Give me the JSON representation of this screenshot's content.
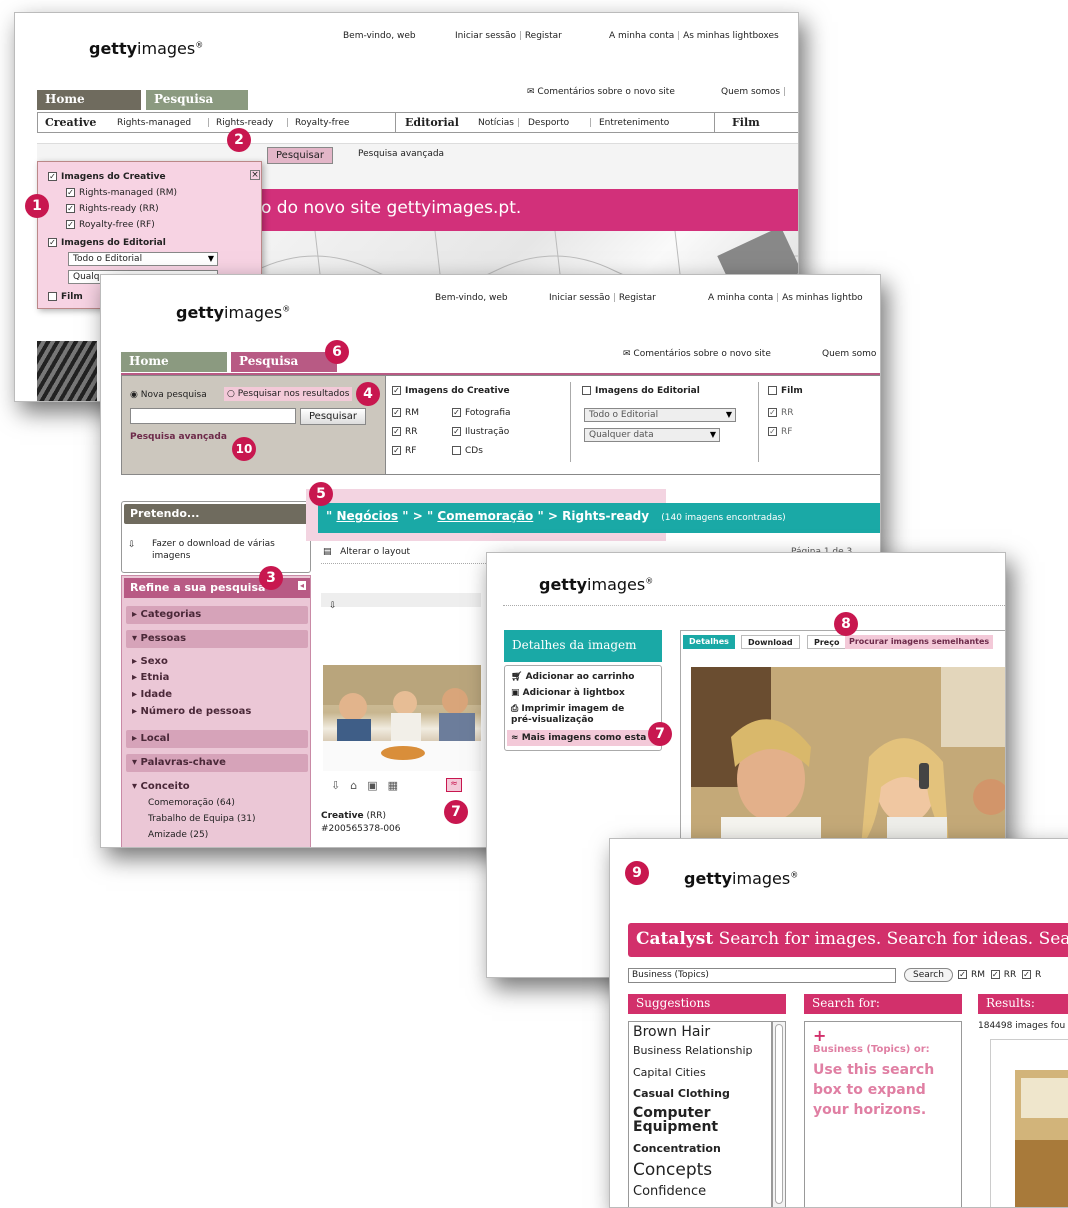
{
  "brand": {
    "logo_bold": "getty",
    "logo_rest": "images",
    "reg": "®"
  },
  "win1": {
    "welcome": "Bem-vindo, web",
    "login": "Iniciar sessão",
    "register": "Registar",
    "account": "A minha conta",
    "lightboxes": "As minhas lightboxes",
    "tab_home": "Home",
    "tab_search": "Pesquisa",
    "feedback": "Comentários sobre o novo site",
    "about": "Quem somos",
    "creative": "Creative",
    "rm": "Rights-managed",
    "rr": "Rights-ready",
    "rf": "Royalty-free",
    "editorial": "Editorial",
    "news": "Notícias",
    "sport": "Desporto",
    "ent": "Entretenimento",
    "film": "Film",
    "search_btn": "Pesquisar",
    "advanced": "Pesquisa avançada",
    "banner": "o do novo site gettyimages.pt.",
    "dropdown": {
      "creative_images": "Imagens do Creative",
      "rm": "Rights-managed (RM)",
      "rr": "Rights-ready (RR)",
      "rf": "Royalty-free (RF)",
      "editorial_images": "Imagens do Editorial",
      "all_editorial": "Todo o Editorial",
      "any_partial": "Qualq",
      "film": "Film",
      "close": "×"
    }
  },
  "win2": {
    "welcome": "Bem-vindo, web",
    "login": "Iniciar sessão",
    "register": "Registar",
    "account": "A minha conta",
    "lightboxes": "As minhas lightbo",
    "tab_home": "Home",
    "tab_search": "Pesquisa",
    "feedback": "Comentários sobre o novo site",
    "about": "Quem somo",
    "new_search": "Nova pesquisa",
    "search_in_results": "Pesquisar nos resultados",
    "search_btn": "Pesquisar",
    "advanced": "Pesquisa avançada",
    "creative_images": "Imagens do Creative",
    "rm": "RM",
    "rr": "RR",
    "rf": "RF",
    "photo": "Fotografia",
    "illus": "Ilustração",
    "cds": "CDs",
    "editorial_images": "Imagens do Editorial",
    "all_editorial": "Todo o Editorial",
    "any_date": "Qualquer data",
    "film": "Film",
    "film_rr": "RR",
    "film_rf": "RF",
    "intend": "Pretendo...",
    "download_multi": "Fazer o download de várias imagens",
    "refine": "Refine a sua pesquisa",
    "categories": "Categorias",
    "people": "Pessoas",
    "sex": "Sexo",
    "ethnicity": "Etnia",
    "age": "Idade",
    "num_people": "Número de pessoas",
    "place": "Local",
    "keywords": "Palavras-chave",
    "concept": "Conceito",
    "kw1": "Comemoração (64)",
    "kw2": "Trabalho de Equipa (31)",
    "kw3": "Amizade (25)",
    "crumb_q1": "\"",
    "crumb_business": "Negócios",
    "crumb_mid": "\" > \"",
    "crumb_celebration": "Comemoração",
    "crumb_end": "\" > Rights-ready",
    "found": "(140 imagens encontradas)",
    "change_layout": "Alterar o layout",
    "page": "Página 1 de 3",
    "img_creative": "Creative",
    "img_rr": "(RR)",
    "img_id": "#200565378-006"
  },
  "win3": {
    "title": "Detalhes da imagem",
    "tab_details": "Detalhes",
    "tab_download": "Download",
    "tab_price": "Preço",
    "tab_similar": "Procurar imagens semelhantes",
    "add_cart": "Adicionar ao carrinho",
    "add_lightbox": "Adicionar à lightbox",
    "print_preview": "Imprimir imagem de pré-visualização",
    "more_like": "Mais imagens como esta"
  },
  "win4": {
    "catalyst": "Catalyst",
    "tagline": "Search for images. Search for ideas. Sea",
    "search_value": "Business (Topics)",
    "search_btn": "Search",
    "rm": "RM",
    "rr": "RR",
    "rx": "R",
    "suggestions": "Suggestions",
    "search_for": "Search for:",
    "results": "Results:",
    "found": "184498 images fou",
    "plus": "+",
    "hint_small": "Business (Topics) or:",
    "hint_big": "Use this search box to expand your horizons.",
    "list": [
      "Brown Hair",
      "Business Relationship",
      "Capital Cities",
      "Casual Clothing",
      "Computer Equipment",
      "Concentration",
      "Concepts",
      "Confidence"
    ]
  },
  "badges": [
    "1",
    "2",
    "3",
    "4",
    "5",
    "6",
    "7",
    "8",
    "9",
    "10"
  ],
  "colors": {
    "pink": "#c8174f",
    "mauve": "#c98aa6",
    "teal": "#1aa9a6",
    "gray_tab": "#6f6b5e",
    "green_tab": "#8b9a80"
  }
}
